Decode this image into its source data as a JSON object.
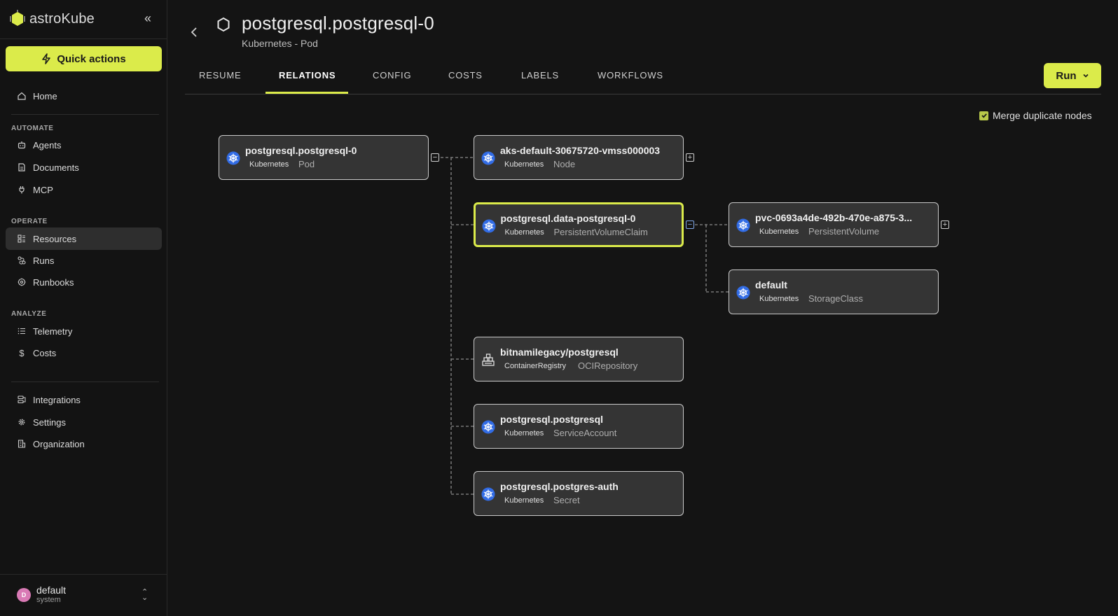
{
  "sidebar": {
    "logo_text": "astroKube",
    "quick_actions": "Quick actions",
    "home": "Home",
    "automate_label": "AUTOMATE",
    "automate": [
      "Agents",
      "Documents",
      "MCP"
    ],
    "operate_label": "OPERATE",
    "operate": [
      "Resources",
      "Runs",
      "Runbooks"
    ],
    "analyze_label": "ANALYZE",
    "analyze": [
      "Telemetry",
      "Costs"
    ],
    "bottom": [
      "Integrations",
      "Settings",
      "Organization"
    ],
    "user": {
      "initial": "D",
      "name": "default",
      "role": "system"
    }
  },
  "header": {
    "title": "postgresql.postgresql-0",
    "subtitle": "Kubernetes - Pod",
    "run_label": "Run"
  },
  "tabs": [
    "RESUME",
    "RELATIONS",
    "CONFIG",
    "COSTS",
    "LABELS",
    "WORKFLOWS"
  ],
  "active_tab": "RELATIONS",
  "merge_label": "Merge duplicate nodes",
  "merge_checked": true,
  "nodes": [
    {
      "name": "postgresql.postgresql-0",
      "provider": "Kubernetes",
      "kind": "Pod",
      "icon": "kubernetes-icon"
    },
    {
      "name": "aks-default-30675720-vmss000003",
      "provider": "Kubernetes",
      "kind": "Node",
      "icon": "kubernetes-icon"
    },
    {
      "name": "postgresql.data-postgresql-0",
      "provider": "Kubernetes",
      "kind": "PersistentVolumeClaim",
      "icon": "kubernetes-icon"
    },
    {
      "name": "pvc-0693a4de-492b-470e-a875-3...",
      "provider": "Kubernetes",
      "kind": "PersistentVolume",
      "icon": "kubernetes-icon"
    },
    {
      "name": "default",
      "provider": "Kubernetes",
      "kind": "StorageClass",
      "icon": "kubernetes-icon"
    },
    {
      "name": "bitnamilegacy/postgresql",
      "provider": "ContainerRegistry",
      "kind": "OCIRepository",
      "icon": "container-registry-icon"
    },
    {
      "name": "postgresql.postgresql",
      "provider": "Kubernetes",
      "kind": "ServiceAccount",
      "icon": "kubernetes-icon"
    },
    {
      "name": "postgresql.postgres-auth",
      "provider": "Kubernetes",
      "kind": "Secret",
      "icon": "kubernetes-icon"
    }
  ],
  "colors": {
    "accent": "#dbeb4a",
    "background": "#141414",
    "node_bg": "#343434",
    "kubernetes_blue": "#326ce5"
  }
}
